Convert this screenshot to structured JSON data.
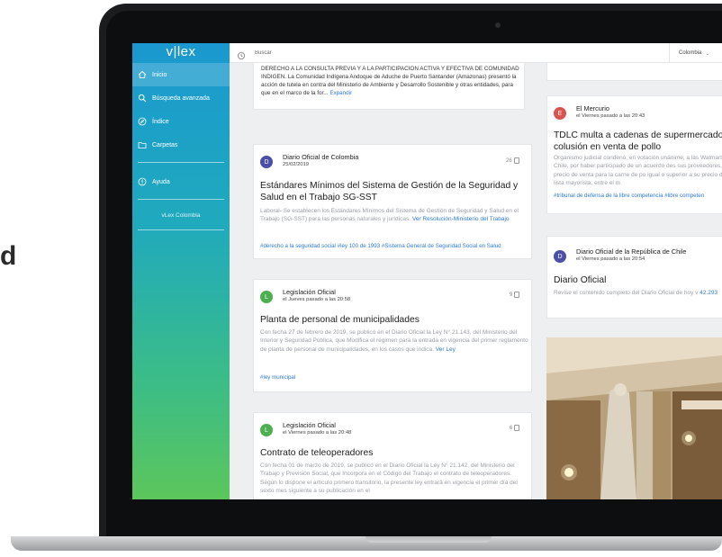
{
  "side_text": "d",
  "sidebar": {
    "logo": "v|lex",
    "items": [
      {
        "label": "Inicio",
        "icon": "home-icon",
        "active": true
      },
      {
        "label": "Búsqueda avanzada",
        "icon": "search-icon"
      },
      {
        "label": "Índice",
        "icon": "compass-icon"
      },
      {
        "label": "Carpetas",
        "icon": "folder-icon"
      }
    ],
    "help": {
      "label": "Ayuda",
      "icon": "help-icon"
    },
    "country": "vLex Colombia"
  },
  "topbar": {
    "search_placeholder": "Buscar",
    "country": "Colombia"
  },
  "feed": {
    "top_excerpt": {
      "text": "DERECHO A LA CONSULTA PREVIA Y A LA PARTICIPACION ACTIVA Y EFECTIVA DE COMUNIDAD INDIGEN. La Comunidad Indígena Andoque de Aduche de Puerto Santander (Amazonas) presentó la acción de tutela en contra del Ministerio de Ambiente y Desarrollo Sostenible y otras entidades, para que en el marco de la for...",
      "link": "Expandir"
    },
    "cards": [
      {
        "avatar": "D",
        "avatar_color": "#4b4fa8",
        "source": "Diario Oficial de Colombia",
        "date": "25/02/2019",
        "count": "26",
        "title": "Estándares Mínimos del Sistema de Gestión de la Seguridad y Salud en el Trabajo SG-SST",
        "desc": "Laboral- Se establecen los Estándares Mínimos del Sistema de Gestión de Seguridad y Salud en el Trabajo (SG-SST) para las personas naturales y jurídicas.",
        "link": "Ver Resolución-Ministerio del Trabajo",
        "tags": "#derecho a la seguridad social #ley 100 de 1993 #Sistema General de Seguridad Social en Salud"
      },
      {
        "avatar": "L",
        "avatar_color": "#4caf50",
        "source": "Legislación Oficial",
        "date": "el Jueves pasado a las 20:58",
        "count": "9",
        "title": "Planta de personal de municipalidades",
        "desc": "Con fecha 27 de febrero de 2019, se publicó en el Diario Oficial la Ley N° 21.143, del Ministerio del Interior y Seguridad Pública, que Modifica el régimen para la entrada en vigencia del primer reglamento de planta de personal de municipalidades, en los casos que indica.",
        "link": "Ver Ley",
        "tags": "#ley municipal"
      },
      {
        "avatar": "L",
        "avatar_color": "#4caf50",
        "source": "Legislación Oficial",
        "date": "el Viernes pasado a las 20:48",
        "count": "6",
        "title": "Contrato de teleoperadores",
        "desc": "Con fecha 01 de marzo de 2019, se publicó en el Diario Oficial la Ley N° 21.142, del Ministerio del Trabajo y Previsión Social, que Incorpora en el Código del Trabajo el contrato de teleoperadores. Según lo dispone el artículo primero transitorio, la presente ley entrará en vigencia el primer día del sexto mes siguiente a su publicación en el",
        "link": "",
        "tags": ""
      }
    ],
    "right_cards": [
      {
        "avatar": "E",
        "avatar_color": "#d9534f",
        "source": "El Mercurio",
        "date": "el Viernes pasado a las 20:43",
        "title": "TDLC multa a cadenas de supermercado colusión en venta de pollo",
        "desc": "Organismo judicial condenó, en votación unánime, a las Walmart Chile, por haber participado de un acuerdo des sus proveedores, un precio de venta para la carne de po igual o superior a su precio de lista mayorista, entre el m",
        "tags": "#tribunal de defensa de la libre competencia #libre competen"
      },
      {
        "avatar": "D",
        "avatar_color": "#4b4fa8",
        "source": "Diario Oficial de la República de Chile",
        "date": "el Viernes pasado a las 20:54",
        "title": "Diario Oficial",
        "desc": "Revise el contenido completo del Diario Oficial de hoy v",
        "link": "42.293"
      }
    ]
  }
}
